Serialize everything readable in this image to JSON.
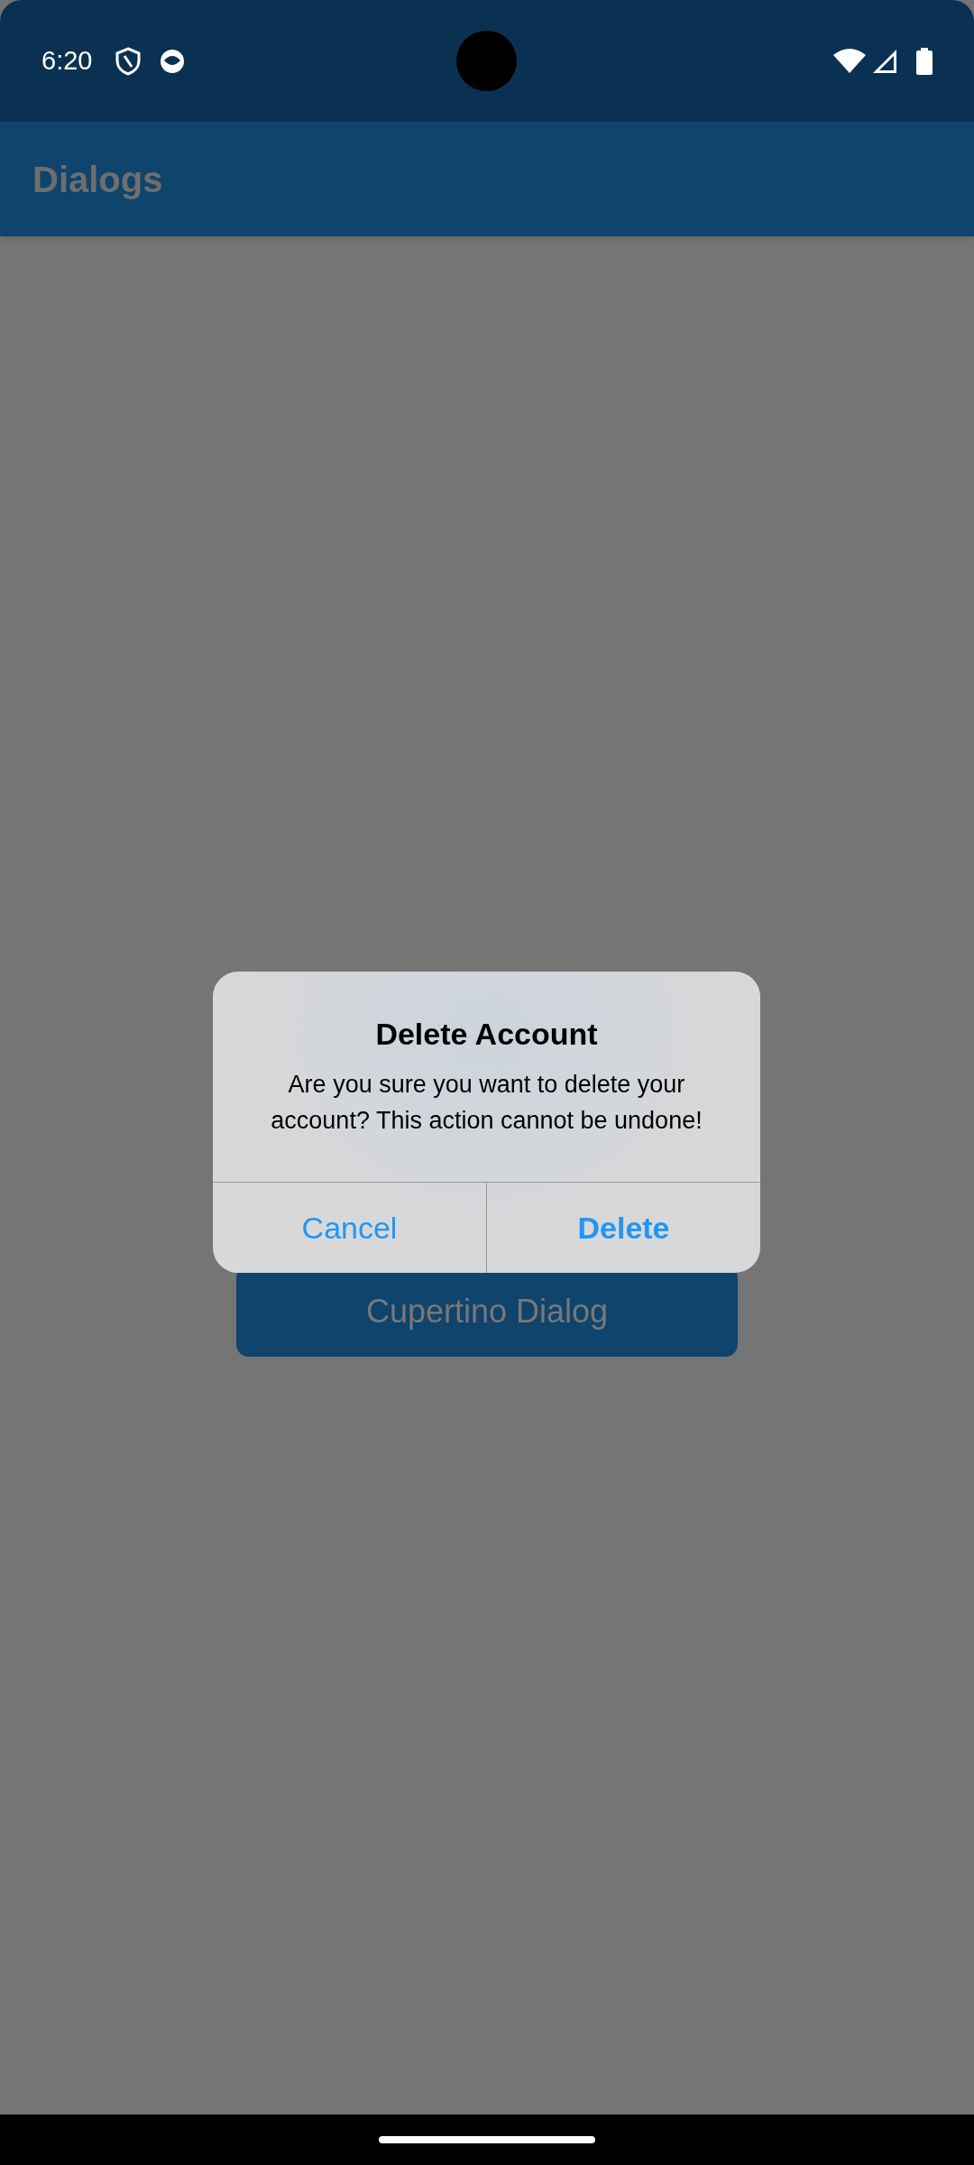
{
  "status_bar": {
    "time": "6:20"
  },
  "app_bar": {
    "title": "Dialogs"
  },
  "main_button": {
    "label": "Cupertino Dialog"
  },
  "dialog": {
    "title": "Delete Account",
    "message": "Are you sure you want to delete your account? This action cannot be undone!",
    "actions": [
      {
        "label": "Cancel",
        "kind": "default"
      },
      {
        "label": "Delete",
        "kind": "destructive"
      }
    ]
  }
}
